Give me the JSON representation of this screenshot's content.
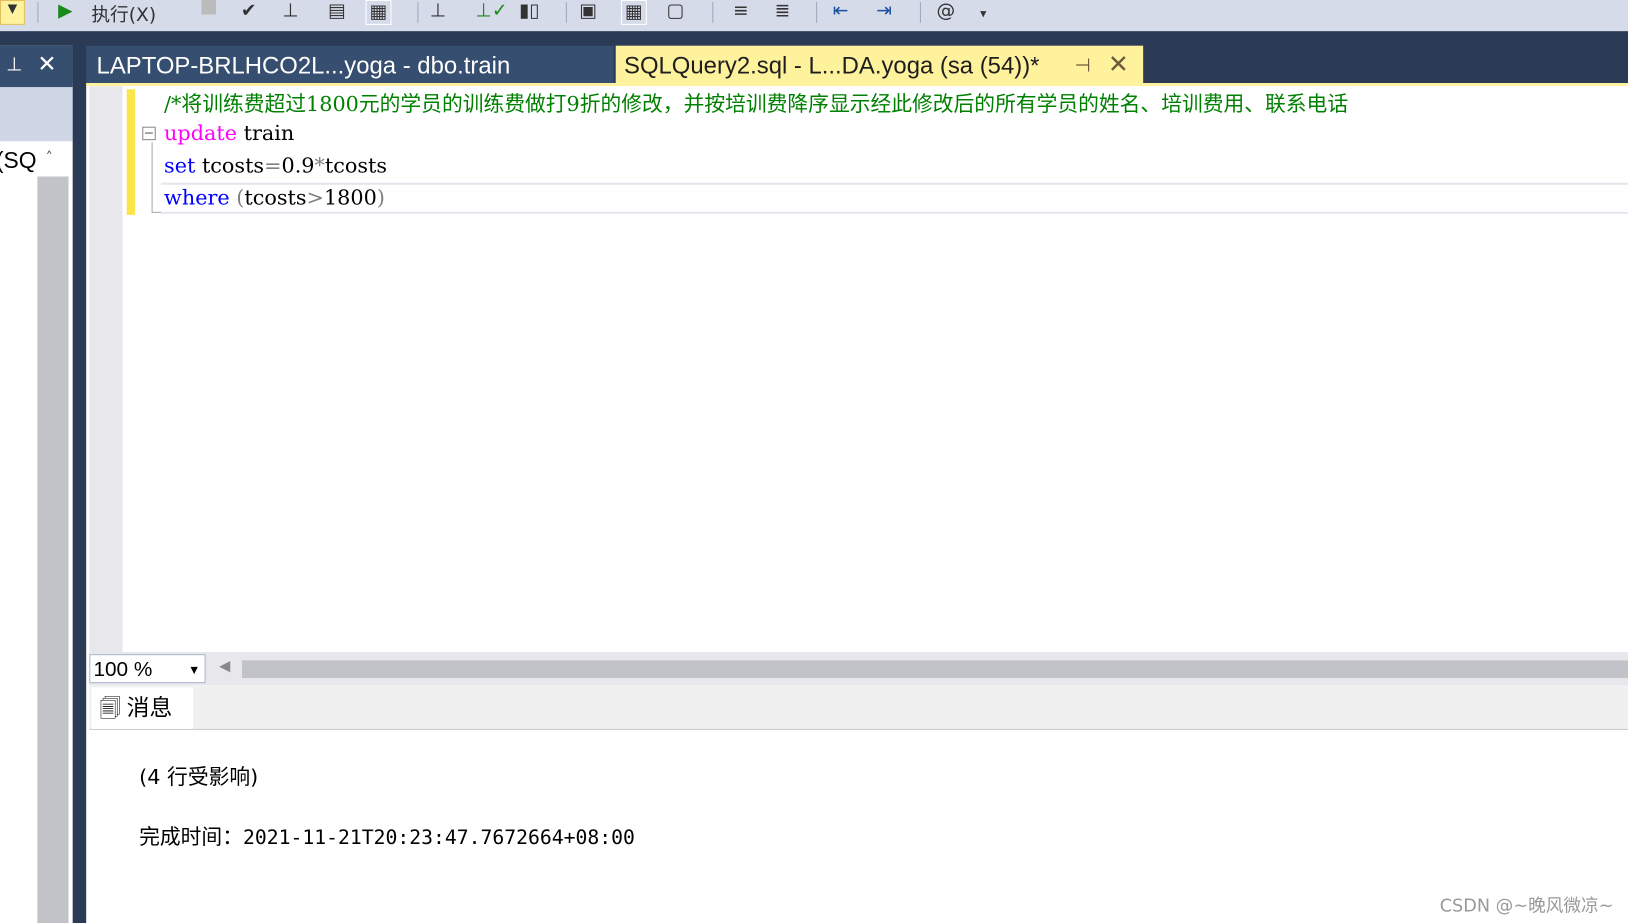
{
  "toolbar": {
    "execute_label": "执行(X)"
  },
  "left_panel": {
    "item_text": "(SQ"
  },
  "tabs": [
    {
      "label": "LAPTOP-BRLHCO2L...yoga - dbo.train",
      "active": false
    },
    {
      "label": "SQLQuery2.sql - L...DA.yoga (sa (54))*",
      "active": true
    }
  ],
  "editor": {
    "comment": "/*将训练费超过1800元的学员的训练费做打9折的修改，并按培训费降序显示经此修改后的所有学员的姓名、培训费用、联系电话",
    "line2": {
      "kw": "update",
      "rest": " train"
    },
    "line3": {
      "kw": "set",
      "a": " tcosts",
      "op1": "=",
      "b": "0.9",
      "op2": "*",
      "c": "tcosts"
    },
    "line4": {
      "kw": "where",
      "sp": " ",
      "p1": "(",
      "a": "tcosts",
      "op": ">",
      "b": "1800",
      "p2": ")"
    }
  },
  "zoom": {
    "value": "100 %"
  },
  "results": {
    "tab_label": "消息",
    "rows_affected": "(4 行受影响)",
    "completion_label": "完成时间：",
    "completion_time": "2021-11-21T20:23:47.7672664+08:00"
  },
  "watermark": "CSDN @~晚风微凉~",
  "colors": {
    "tab_active": "#fff29d",
    "tab_inactive": "#364e6f",
    "keyword": "#0000ff",
    "comment": "#008000",
    "dml": "#ff00ff"
  }
}
